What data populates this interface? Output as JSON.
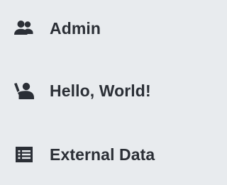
{
  "sidebar": {
    "items": [
      {
        "label": "Admin",
        "icon": "people-group-icon"
      },
      {
        "label": "Hello, World!",
        "icon": "person-waving-icon"
      },
      {
        "label": "External Data",
        "icon": "table-list-icon"
      }
    ]
  },
  "colors": {
    "background": "#e8ebee",
    "text": "#2b2f36",
    "icon": "#2b2f36"
  }
}
